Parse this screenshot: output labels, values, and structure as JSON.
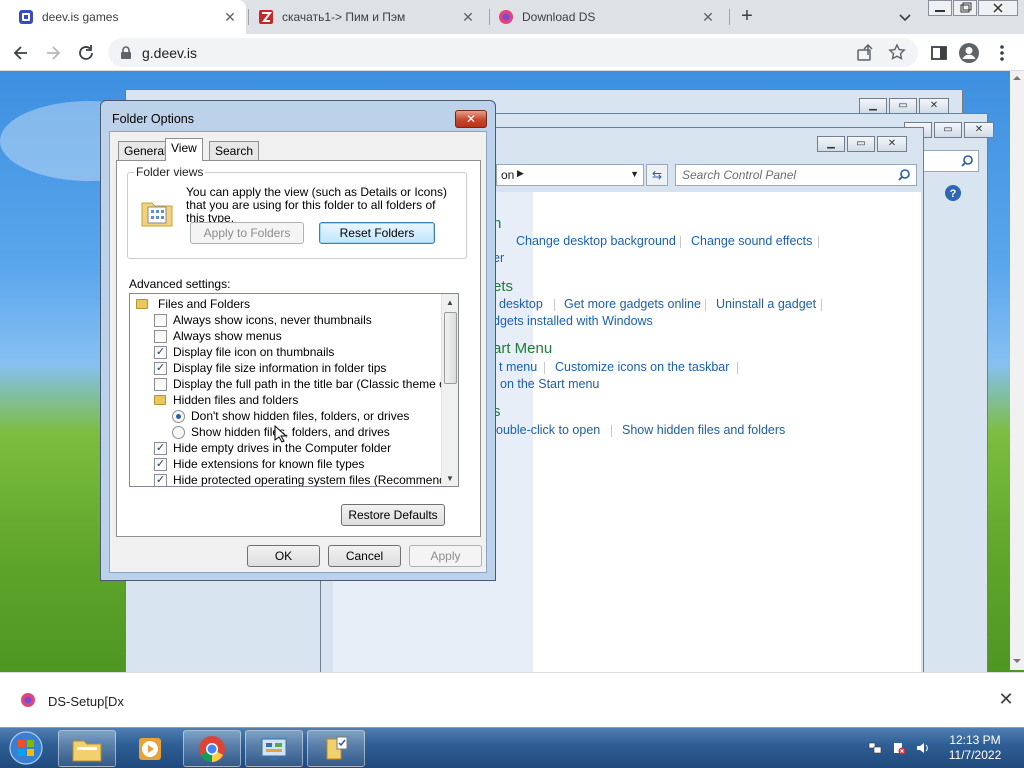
{
  "browser": {
    "tabs": [
      {
        "title": "deev.is games",
        "active": true
      },
      {
        "title": "скачать1-> Пим и Пэм",
        "active": false
      },
      {
        "title": "Download DS",
        "active": false
      }
    ],
    "url": "g.deev.is",
    "accent": "#1a73e8"
  },
  "control_panel": {
    "address_tail": "on",
    "search_placeholder": "Search Control Panel",
    "sections": [
      {
        "heading": "n",
        "links": [
          "Change desktop background",
          "Change sound effects"
        ]
      },
      {
        "heading": "er",
        "links": []
      },
      {
        "heading": "ets",
        "links": [
          "desktop",
          "Get more gadgets online",
          "Uninstall a gadget"
        ]
      },
      {
        "heading": "",
        "links": [
          "dgets installed with Windows"
        ]
      },
      {
        "heading": "art Menu",
        "links": [
          "t menu",
          "Customize icons on the taskbar"
        ]
      },
      {
        "heading": "",
        "links": [
          "on the Start menu"
        ]
      },
      {
        "heading": "s",
        "links": [
          "ouble-click to open",
          "Show hidden files and folders"
        ]
      }
    ]
  },
  "dialog": {
    "title": "Folder Options",
    "tabs": [
      "General",
      "View",
      "Search"
    ],
    "active_tab": "View",
    "folder_views": {
      "legend": "Folder views",
      "text": "You can apply the view (such as Details or Icons) that you are using for this folder to all folders of this type.",
      "apply_button": "Apply to Folders",
      "reset_button": "Reset Folders"
    },
    "advanced_label": "Advanced settings:",
    "advanced_items": [
      {
        "kind": "folder",
        "label": "Files and Folders",
        "indent": 0
      },
      {
        "kind": "checkbox",
        "label": "Always show icons, never thumbnails",
        "checked": false,
        "indent": 1
      },
      {
        "kind": "checkbox",
        "label": "Always show menus",
        "checked": false,
        "indent": 1
      },
      {
        "kind": "checkbox",
        "label": "Display file icon on thumbnails",
        "checked": true,
        "indent": 1
      },
      {
        "kind": "checkbox",
        "label": "Display file size information in folder tips",
        "checked": true,
        "indent": 1
      },
      {
        "kind": "checkbox",
        "label": "Display the full path in the title bar (Classic theme only)",
        "checked": false,
        "indent": 1
      },
      {
        "kind": "folder",
        "label": "Hidden files and folders",
        "indent": 1
      },
      {
        "kind": "radio",
        "label": "Don't show hidden files, folders, or drives",
        "checked": true,
        "indent": 2
      },
      {
        "kind": "radio",
        "label": "Show hidden files, folders, and drives",
        "checked": false,
        "indent": 2
      },
      {
        "kind": "checkbox",
        "label": "Hide empty drives in the Computer folder",
        "checked": true,
        "indent": 1
      },
      {
        "kind": "checkbox",
        "label": "Hide extensions for known file types",
        "checked": true,
        "indent": 1
      },
      {
        "kind": "checkbox",
        "label": "Hide protected operating system files (Recommended)",
        "checked": true,
        "indent": 1
      }
    ],
    "restore_button": "Restore Defaults",
    "ok_button": "OK",
    "cancel_button": "Cancel",
    "apply_button": "Apply"
  },
  "download_bar": {
    "file": "DS-Setup[Dx"
  },
  "taskbar": {
    "time": "12:13 PM",
    "date": "11/7/2022"
  }
}
